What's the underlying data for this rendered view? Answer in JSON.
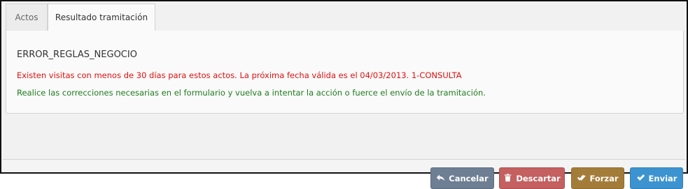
{
  "tabs": [
    {
      "label": "Actos"
    },
    {
      "label": "Resultado tramitación"
    }
  ],
  "result": {
    "error_code": "ERROR_REGLAS_NEGOCIO",
    "error_message": "Existen visitas con menos de 30 días para estos actos. La próxima fecha válida es el 04/03/2013. 1-CONSULTA",
    "hint_message": "Realice las correcciones necesarias en el formulario y vuelva a intentar la acción o fuerce el envío de la tramitación."
  },
  "buttons": {
    "cancel": {
      "label": "Cancelar",
      "icon": "reply-arrow-icon",
      "color": "#6e7f94"
    },
    "discard": {
      "label": "Descartar",
      "icon": "trash-icon",
      "color": "#c46060"
    },
    "force": {
      "label": "Forzar",
      "icon": "double-check-icon",
      "color": "#a47c3a"
    },
    "send": {
      "label": "Enviar",
      "icon": "check-icon",
      "color": "#3d93d0"
    }
  },
  "colors": {
    "error_text": "#e01010",
    "hint_text": "#1f7a1f"
  }
}
